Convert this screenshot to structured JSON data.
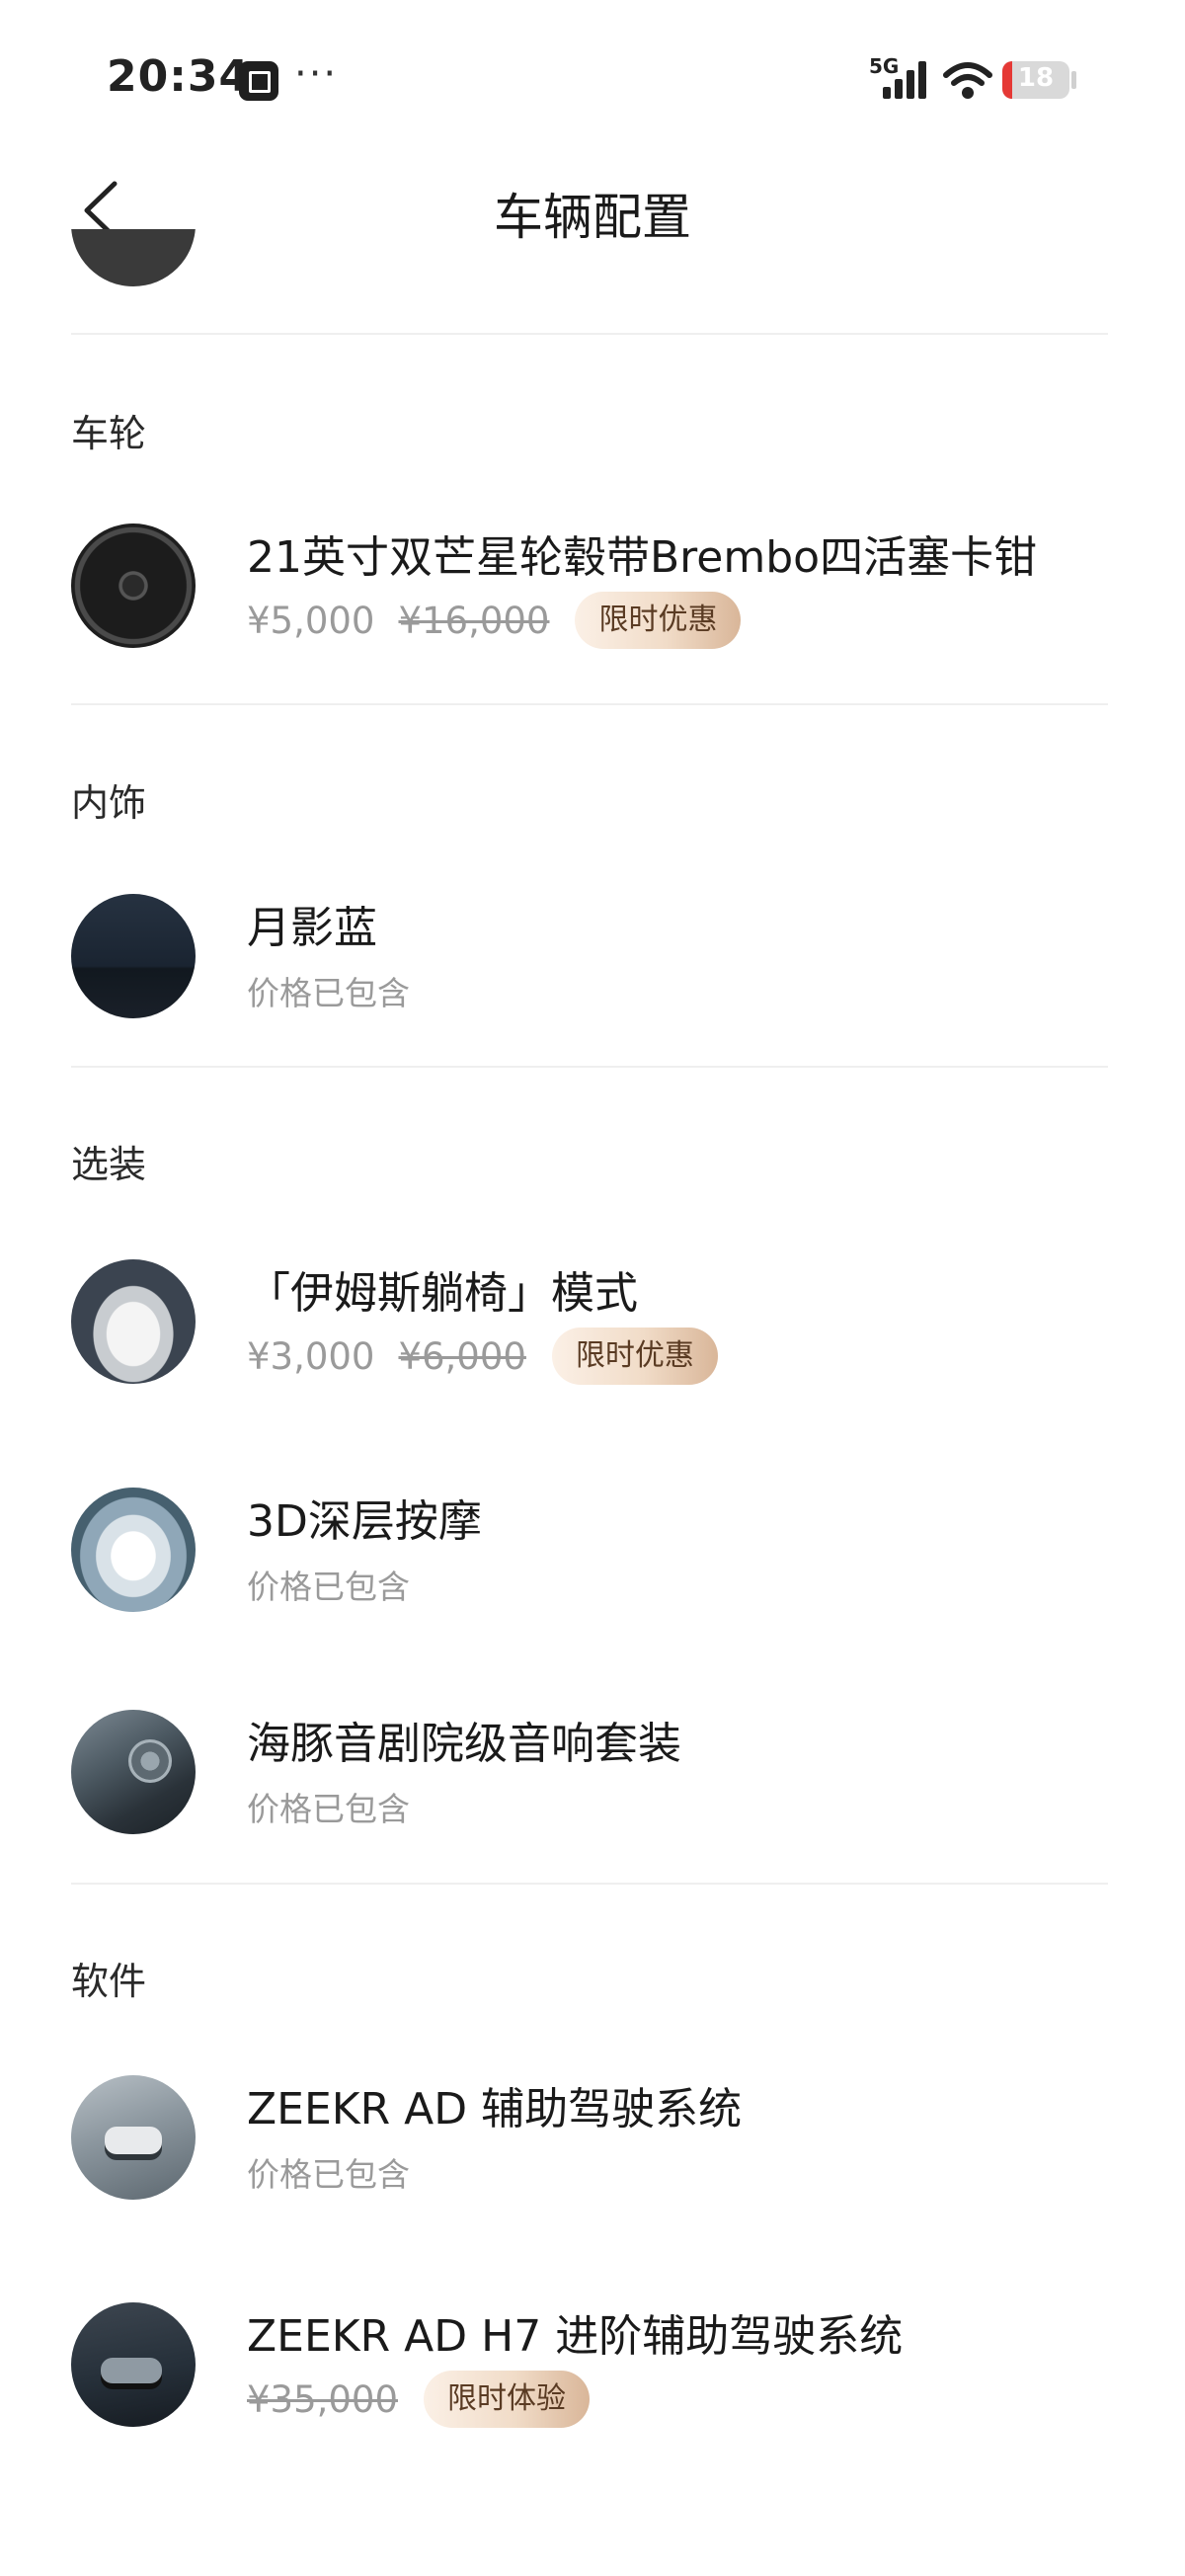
{
  "status_bar": {
    "time": "20:34",
    "more": "···",
    "network": "5G",
    "battery": "18",
    "icons": [
      "app-notification-icon",
      "signal-icon",
      "wifi-icon",
      "battery-icon"
    ]
  },
  "header": {
    "title": "车辆配置",
    "back_icon": "chevron-left-icon"
  },
  "sections": {
    "wheels": {
      "title": "车轮",
      "items": [
        {
          "name": "21英寸双芒星轮毂带Brembo四活塞卡钳",
          "price": "¥5,000",
          "original_price": "¥16,000",
          "badge": "限时优惠"
        }
      ]
    },
    "interior": {
      "title": "内饰",
      "items": [
        {
          "name": "月影蓝",
          "note": "价格已包含"
        }
      ]
    },
    "options": {
      "title": "选装",
      "items": [
        {
          "name": "「伊姆斯躺椅」模式",
          "price": "¥3,000",
          "original_price": "¥6,000",
          "badge": "限时优惠"
        },
        {
          "name": "3D深层按摩",
          "note": "价格已包含"
        },
        {
          "name": "海豚音剧院级音响套装",
          "note": "价格已包含"
        }
      ]
    },
    "software": {
      "title": "软件",
      "items": [
        {
          "name": "ZEEKR AD 辅助驾驶系统",
          "note": "价格已包含"
        },
        {
          "name": "ZEEKR AD H7 进阶辅助驾驶系统",
          "original_price": "¥35,000",
          "badge": "限时体验"
        }
      ]
    }
  },
  "colors": {
    "badge_gradient_start": "#fbf0e6",
    "badge_gradient_end": "#d9b699",
    "battery_low": "#e53935"
  }
}
